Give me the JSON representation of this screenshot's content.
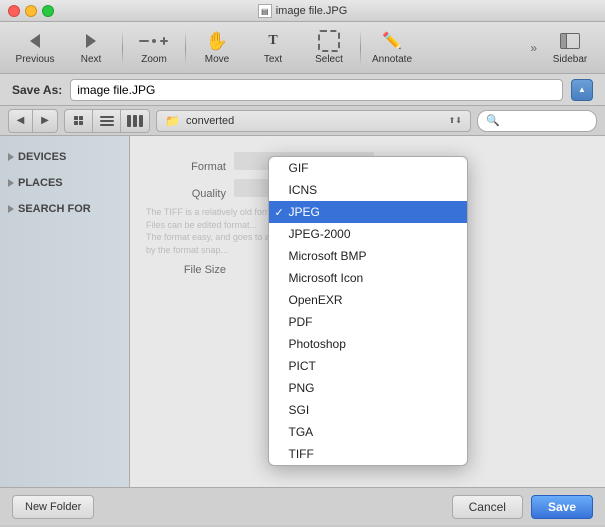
{
  "titlebar": {
    "title": "image file.JPG"
  },
  "toolbar": {
    "buttons": [
      {
        "id": "previous",
        "label": "Previous",
        "icon": "arrow-left"
      },
      {
        "id": "next",
        "label": "Next",
        "icon": "arrow-right"
      },
      {
        "id": "zoom",
        "label": "Zoom",
        "icon": "zoom"
      },
      {
        "id": "move",
        "label": "Move",
        "icon": "hand"
      },
      {
        "id": "text",
        "label": "Text",
        "icon": "text-t"
      },
      {
        "id": "select",
        "label": "Select",
        "icon": "select-dashed"
      },
      {
        "id": "annotate",
        "label": "Annotate",
        "icon": "pencil"
      },
      {
        "id": "sidebar",
        "label": "Sidebar",
        "icon": "sidebar-panel"
      }
    ]
  },
  "save_as": {
    "label": "Save As:",
    "value": "image file.JPG"
  },
  "nav": {
    "folder": "converted",
    "search_placeholder": ""
  },
  "sidebar": {
    "sections": [
      {
        "label": "DEVICES",
        "id": "devices"
      },
      {
        "label": "PLACES",
        "id": "places"
      },
      {
        "label": "SEARCH FOR",
        "id": "search-for"
      }
    ]
  },
  "preview": {
    "format_label": "Format",
    "quality_label": "Quality",
    "filesize_label": "File Size",
    "text_lines": [
      "The TIFF is a relatively old format.",
      "Files can be edited format...",
      "The format easy, and goes to a lot of...",
      "by the format snap..."
    ]
  },
  "dropdown": {
    "items": [
      {
        "label": "GIF",
        "selected": false
      },
      {
        "label": "ICNS",
        "selected": false
      },
      {
        "label": "JPEG",
        "selected": true
      },
      {
        "label": "JPEG-2000",
        "selected": false
      },
      {
        "label": "Microsoft BMP",
        "selected": false
      },
      {
        "label": "Microsoft Icon",
        "selected": false
      },
      {
        "label": "OpenEXR",
        "selected": false
      },
      {
        "label": "PDF",
        "selected": false
      },
      {
        "label": "Photoshop",
        "selected": false
      },
      {
        "label": "PICT",
        "selected": false
      },
      {
        "label": "PNG",
        "selected": false
      },
      {
        "label": "SGI",
        "selected": false
      },
      {
        "label": "TGA",
        "selected": false
      },
      {
        "label": "TIFF",
        "selected": false
      }
    ]
  },
  "bottom": {
    "new_folder": "New Folder",
    "cancel": "Cancel",
    "save": "Save"
  }
}
